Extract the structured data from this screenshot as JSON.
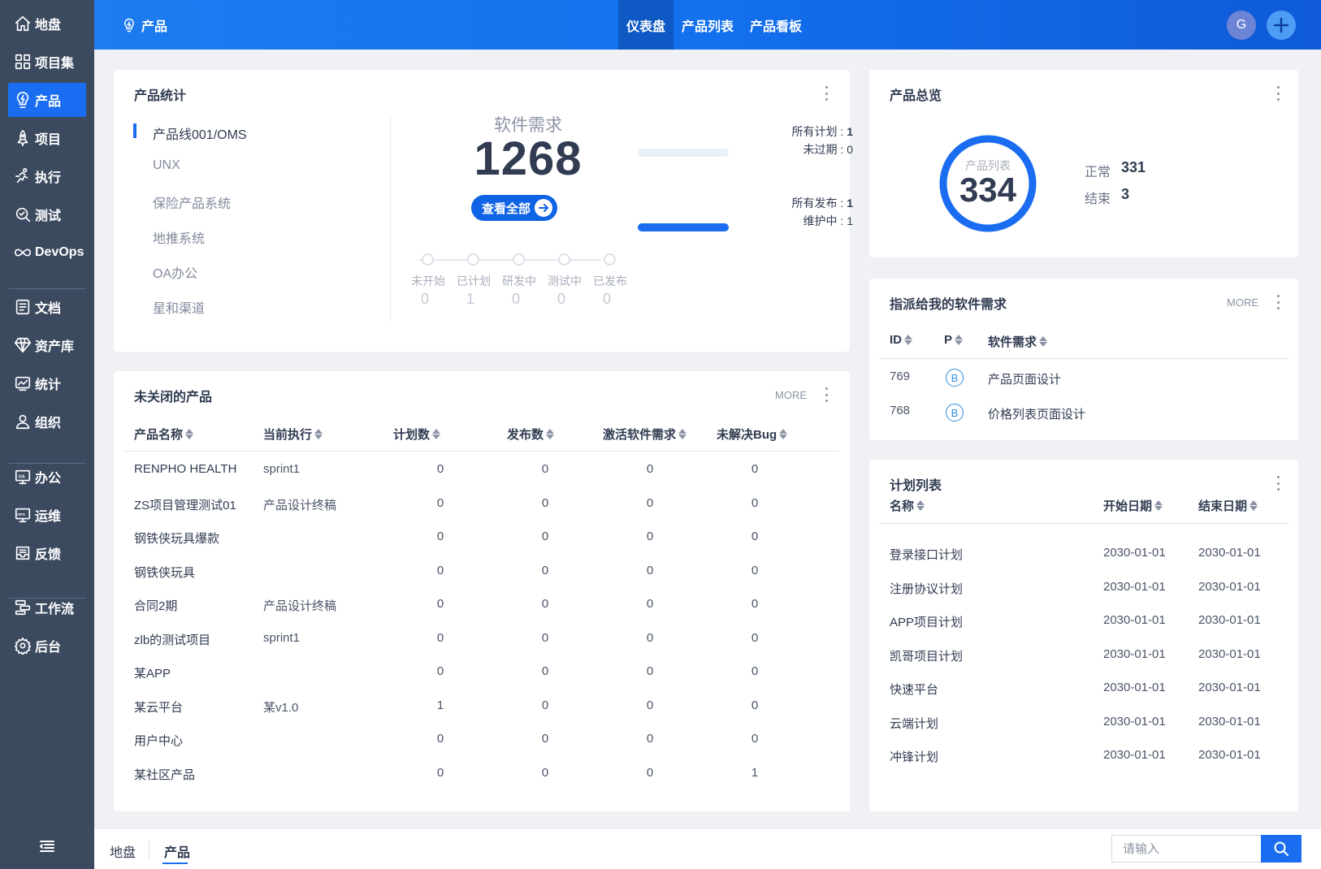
{
  "sidebar": {
    "items": [
      {
        "label": "地盘",
        "icon": "home-icon"
      },
      {
        "label": "项目集",
        "icon": "grid-icon"
      },
      {
        "label": "产品",
        "icon": "bulb-icon"
      },
      {
        "label": "项目",
        "icon": "rocket-icon"
      },
      {
        "label": "执行",
        "icon": "run-icon"
      },
      {
        "label": "测试",
        "icon": "search-check-icon"
      },
      {
        "label": "DevOps",
        "icon": "infinity-icon"
      },
      {
        "label": "文档",
        "icon": "doc-list-icon"
      },
      {
        "label": "资产库",
        "icon": "diamond-icon"
      },
      {
        "label": "统计",
        "icon": "chart-icon"
      },
      {
        "label": "组织",
        "icon": "user-icon"
      },
      {
        "label": "办公",
        "icon": "oa-icon"
      },
      {
        "label": "运维",
        "icon": "ops-icon"
      },
      {
        "label": "反馈",
        "icon": "inbox-icon"
      },
      {
        "label": "工作流",
        "icon": "workflow-icon"
      },
      {
        "label": "后台",
        "icon": "gear-icon"
      }
    ],
    "active_label": "产品"
  },
  "header": {
    "title": "产品",
    "tabs": [
      "仪表盘",
      "产品列表",
      "产品看板"
    ],
    "active_tab": "仪表盘",
    "avatar_initial": "G"
  },
  "product_stats": {
    "title": "产品统计",
    "product_lines": [
      "产品线001/OMS",
      "UNX",
      "保险产品系统",
      "地推系统",
      "OA办公",
      "星和渠道"
    ],
    "stat_label": "软件需求",
    "stat_value": "1268",
    "view_all": "查看全部",
    "stages": [
      {
        "label": "未开始",
        "value": "0"
      },
      {
        "label": "已计划",
        "value": "1"
      },
      {
        "label": "研发中",
        "value": "0"
      },
      {
        "label": "测试中",
        "value": "0"
      },
      {
        "label": "已发布",
        "value": "0"
      }
    ],
    "plans_label": "所有计划 : ",
    "plans_value": "1",
    "unexpired_label": "未过期 : ",
    "unexpired_value": "0",
    "plans_fill": 0,
    "releases_label": "所有发布 : ",
    "releases_value": "1",
    "maintaining_label": "维护中 : ",
    "maintaining_value": "1",
    "releases_fill": 1
  },
  "overview": {
    "title": "产品总览",
    "ring_label": "产品列表",
    "ring_value": "334",
    "normal_label": "正常",
    "normal_value": "331",
    "closed_label": "结束",
    "closed_value": "3"
  },
  "assigned": {
    "title": "指派给我的软件需求",
    "more": "MORE",
    "columns": [
      "ID",
      "P",
      "软件需求"
    ],
    "rows": [
      {
        "id": "769",
        "p": "B",
        "name": "产品页面设计"
      },
      {
        "id": "768",
        "p": "B",
        "name": "价格列表页面设计"
      }
    ]
  },
  "unclosed": {
    "title": "未关闭的产品",
    "more": "MORE",
    "columns": [
      "产品名称",
      "当前执行",
      "计划数",
      "发布数",
      "激活软件需求",
      "未解决Bug"
    ],
    "rows": [
      [
        "RENPHO HEALTH",
        "sprint1",
        "0",
        "0",
        "0",
        "0"
      ],
      [
        "ZS项目管理测试01",
        "产品设计终稿",
        "0",
        "0",
        "0",
        "0"
      ],
      [
        "钢铁侠玩具爆款",
        "",
        "0",
        "0",
        "0",
        "0"
      ],
      [
        "钢铁侠玩具",
        "",
        "0",
        "0",
        "0",
        "0"
      ],
      [
        "合同2期",
        "产品设计终稿",
        "0",
        "0",
        "0",
        "0"
      ],
      [
        "zlb的测试项目",
        "sprint1",
        "0",
        "0",
        "0",
        "0"
      ],
      [
        "某APP",
        "",
        "0",
        "0",
        "0",
        "0"
      ],
      [
        "某云平台",
        "某v1.0",
        "1",
        "0",
        "0",
        "0"
      ],
      [
        "用户中心",
        "",
        "0",
        "0",
        "0",
        "0"
      ],
      [
        "某社区产品",
        "",
        "0",
        "0",
        "0",
        "1"
      ]
    ]
  },
  "plans": {
    "title": "计划列表",
    "columns": [
      "名称",
      "开始日期",
      "结束日期"
    ],
    "rows": [
      [
        "登录接口计划",
        "2030-01-01",
        "2030-01-01"
      ],
      [
        "注册协议计划",
        "2030-01-01",
        "2030-01-01"
      ],
      [
        "APP项目计划",
        "2030-01-01",
        "2030-01-01"
      ],
      [
        "凯哥项目计划",
        "2030-01-01",
        "2030-01-01"
      ],
      [
        "快速平台",
        "2030-01-01",
        "2030-01-01"
      ],
      [
        "云端计划",
        "2030-01-01",
        "2030-01-01"
      ],
      [
        "冲锋计划",
        "2030-01-01",
        "2030-01-01"
      ]
    ]
  },
  "bottombar": {
    "tabs": [
      "地盘",
      "产品"
    ],
    "active_tab": "产品",
    "search_placeholder": "请输入"
  },
  "colors": {
    "accent": "#1a6df0",
    "sidebar_bg": "#3c4a60",
    "header_start": "#1d7cef",
    "header_end": "#0e5ad8"
  }
}
